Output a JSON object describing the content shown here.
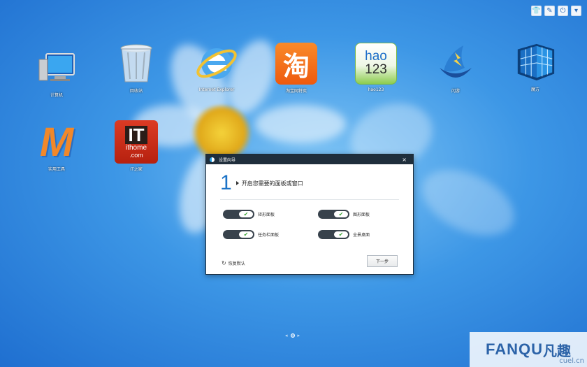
{
  "desktop": {
    "icons": [
      {
        "label": "计算机"
      },
      {
        "label": "回收站"
      },
      {
        "label": "Internet Explorer"
      },
      {
        "label": "淘宝网特卖"
      },
      {
        "label": "hao123"
      },
      {
        "label": "闪游"
      },
      {
        "label": "魔方"
      },
      {
        "label": "实用工具"
      },
      {
        "label": "IT之家"
      }
    ]
  },
  "top_controls": {
    "shirt": "👕",
    "edit": "✎",
    "power": "⏻",
    "down": "▾"
  },
  "icon_glyphs": {
    "taobao": "淘",
    "hao": "hao",
    "hao_num": "123",
    "it": "IT",
    "ithome": "ithome",
    "ithome_com": ".com",
    "maxthon": "M"
  },
  "dialog": {
    "title": "设置向导",
    "close": "×",
    "step_number": "1",
    "step_text": "开启您需要的面板或窗口",
    "options": [
      {
        "label": "矩形面板",
        "checked": true
      },
      {
        "label": "图形面板",
        "checked": true
      },
      {
        "label": "任务栏面板",
        "checked": true
      },
      {
        "label": "全景桌面",
        "checked": true
      }
    ],
    "check_mark": "✔",
    "restore_icon": "↻",
    "restore_label": "恢复默认",
    "next_label": "下一步"
  },
  "pager": {
    "prev": "◂",
    "next": "▸"
  },
  "watermark": {
    "main": "FANQU",
    "cn": "凡趣",
    "sub": "cuel.cn"
  }
}
